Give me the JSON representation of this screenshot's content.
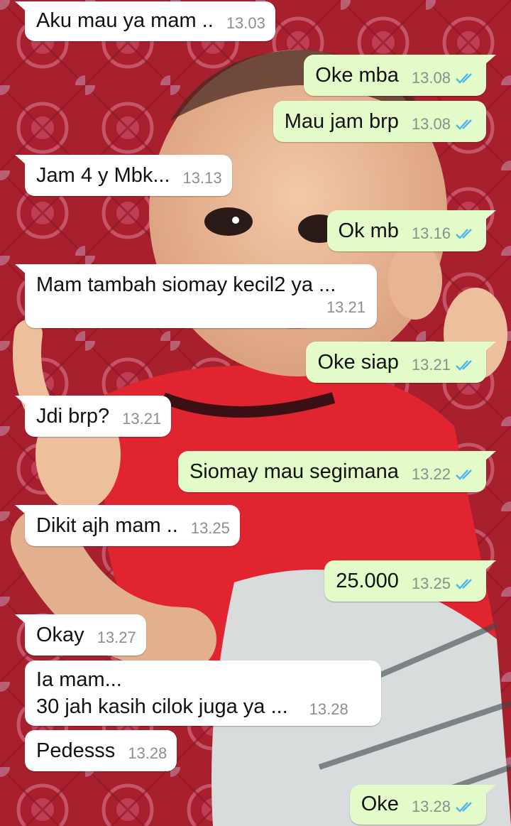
{
  "chat": {
    "messages": [
      {
        "dir": "in",
        "text": "Aku mau ya mam ..",
        "time": "13.03"
      },
      {
        "dir": "out",
        "text": "Oke mba",
        "time": "13.08",
        "status": "read"
      },
      {
        "dir": "out",
        "text": "Mau jam brp",
        "time": "13.08",
        "status": "read"
      },
      {
        "dir": "in",
        "text": "Jam 4 y Mbk...",
        "time": "13.13"
      },
      {
        "dir": "out",
        "text": "Ok mb",
        "time": "13.16",
        "status": "read"
      },
      {
        "dir": "in",
        "text": "Mam tambah siomay kecil2 ya ...",
        "time": "13.21"
      },
      {
        "dir": "out",
        "text": "Oke siap",
        "time": "13.21",
        "status": "read"
      },
      {
        "dir": "in",
        "text": "Jdi brp?",
        "time": "13.21"
      },
      {
        "dir": "out",
        "text": "Siomay mau segimana",
        "time": "13.22",
        "status": "read"
      },
      {
        "dir": "in",
        "text": "Dikit ajh mam ..",
        "time": "13.25"
      },
      {
        "dir": "out",
        "text": "25.000",
        "time": "13.25",
        "status": "read"
      },
      {
        "dir": "in",
        "text": "Okay",
        "time": "13.27"
      },
      {
        "dir": "in",
        "text": "Ia mam...",
        "text2": "30 jah kasih cilok juga ya ...",
        "time": "13.28"
      },
      {
        "dir": "in",
        "text": "Pedesss",
        "time": "13.28"
      },
      {
        "dir": "out",
        "text": "Oke",
        "time": "13.28",
        "status": "read"
      }
    ]
  },
  "colors": {
    "incoming_bubble": "#ffffff",
    "outgoing_bubble": "#e2fbc8",
    "read_ticks": "#4fb6ec",
    "timestamp": "#8a8f8c"
  },
  "icons": {
    "read_status": "double-check-icon"
  }
}
